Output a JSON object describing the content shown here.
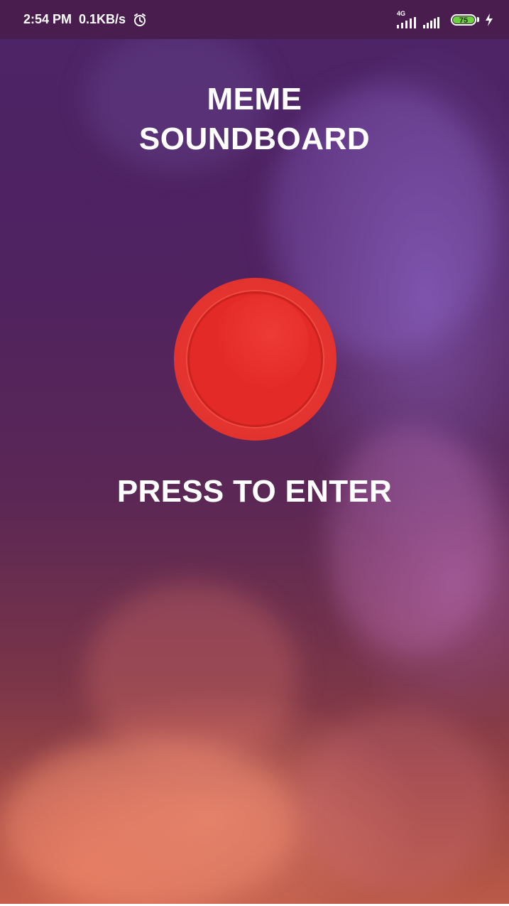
{
  "status_bar": {
    "time": "2:54 PM",
    "speed": "0.1KB/s",
    "network_type": "4G",
    "battery": "75",
    "icons": [
      "alarm-icon",
      "signal-4g-icon",
      "signal-icon",
      "battery-icon",
      "charging-icon"
    ]
  },
  "app": {
    "title_line1": "MEME",
    "title_line2": "SOUNDBOARD",
    "enter_label": "PRESS TO ENTER"
  },
  "colors": {
    "status_bar": "#4a1d4f",
    "button_red": "#e42a26",
    "text": "#ffffff",
    "battery_green": "#6ccf3e"
  }
}
